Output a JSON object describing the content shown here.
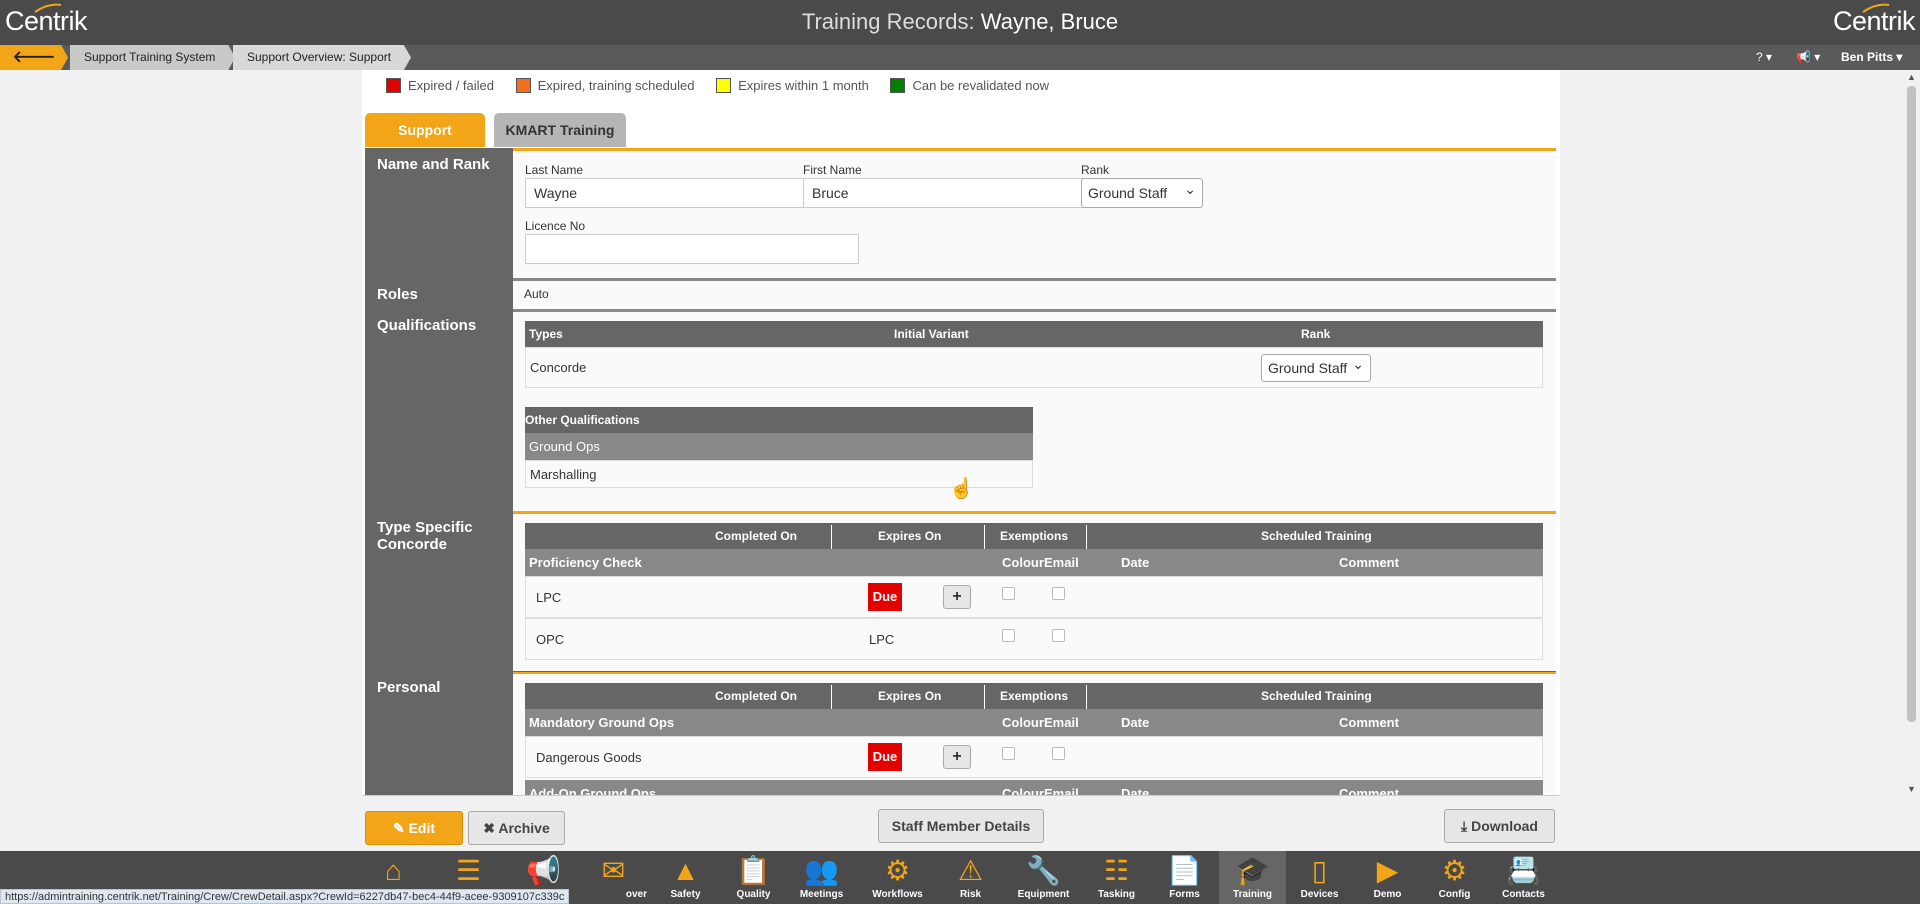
{
  "header": {
    "logo_text": "Centrik",
    "title_prefix": "Training Records:",
    "title_name": "Wayne, Bruce"
  },
  "breadcrumb": {
    "back_icon": "arrow-left-icon",
    "items": [
      "Support Training System",
      "Support Overview: Support"
    ]
  },
  "topright": {
    "help_icon": "question-icon",
    "announce_icon": "megaphone-icon",
    "user": "Ben Pitts"
  },
  "legend": [
    {
      "label": "Expired / failed",
      "color": "#e30000"
    },
    {
      "label": "Expired, training scheduled",
      "color": "#f07020"
    },
    {
      "label": "Expires within 1 month",
      "color": "#ffff00"
    },
    {
      "label": "Can be revalidated now",
      "color": "#008000"
    }
  ],
  "tabs": [
    "Support",
    "KMART Training"
  ],
  "name_rank": {
    "section": "Name and Rank",
    "last_name_label": "Last Name",
    "last_name": "Wayne",
    "first_name_label": "First Name",
    "first_name": "Bruce",
    "rank_label": "Rank",
    "rank": "Ground Staff",
    "licence_label": "Licence No",
    "licence": ""
  },
  "roles": {
    "section": "Roles",
    "value": "Auto"
  },
  "qualifications": {
    "section": "Qualifications",
    "headers": [
      "Types",
      "Initial Variant",
      "Rank"
    ],
    "rows": [
      {
        "type": "Concorde",
        "variant": "",
        "rank": "Ground Staff"
      }
    ],
    "other_header": "Other Qualifications",
    "other_group": "Ground Ops",
    "other_items": [
      "Marshalling"
    ]
  },
  "type_specific": {
    "section": "Type Specific Concorde",
    "headers": [
      "Completed On",
      "Expires On",
      "Exemptions",
      "Scheduled Training"
    ],
    "subheader": "Proficiency Check",
    "subcols": [
      "Colour",
      "Email",
      "Date",
      "Comment"
    ],
    "rows": [
      {
        "name": "LPC",
        "expires": "Due"
      },
      {
        "name": "OPC",
        "expires": "LPC"
      }
    ]
  },
  "personal": {
    "section": "Personal",
    "headers": [
      "Completed On",
      "Expires On",
      "Exemptions",
      "Scheduled Training"
    ],
    "subheader": "Mandatory Ground Ops",
    "subcols": [
      "Colour",
      "Email",
      "Date",
      "Comment"
    ],
    "rows": [
      {
        "name": "Dangerous Goods",
        "expires": "Due"
      }
    ],
    "subheader2": "Add-On Ground Ops"
  },
  "buttons": {
    "edit": "Edit",
    "archive": "Archive",
    "staff": "Staff Member Details",
    "download": "Download"
  },
  "nav": [
    {
      "label": "",
      "icon": "home-icon"
    },
    {
      "label": "",
      "icon": "layers-icon"
    },
    {
      "label": "",
      "icon": "megaphone-icon"
    },
    {
      "label": "over",
      "icon": "mail-icon"
    },
    {
      "label": "Safety",
      "icon": "cone-icon"
    },
    {
      "label": "Quality",
      "icon": "clipboard-icon"
    },
    {
      "label": "Meetings",
      "icon": "people-icon"
    },
    {
      "label": "Workflows",
      "icon": "workflow-icon"
    },
    {
      "label": "Risk",
      "icon": "warning-icon"
    },
    {
      "label": "Equipment",
      "icon": "wrench-icon"
    },
    {
      "label": "Tasking",
      "icon": "tasks-icon"
    },
    {
      "label": "Forms",
      "icon": "forms-icon"
    },
    {
      "label": "Training",
      "icon": "training-icon"
    },
    {
      "label": "Devices",
      "icon": "tablet-icon"
    },
    {
      "label": "Demo",
      "icon": "play-icon"
    },
    {
      "label": "Config",
      "icon": "gear-icon"
    },
    {
      "label": "Contacts",
      "icon": "contacts-icon"
    }
  ],
  "status_url": "https://admintraining.centrik.net/Training/Crew/CrewDetail.aspx?CrewId=6227db47-bec4-44f9-acee-9309107c339c"
}
